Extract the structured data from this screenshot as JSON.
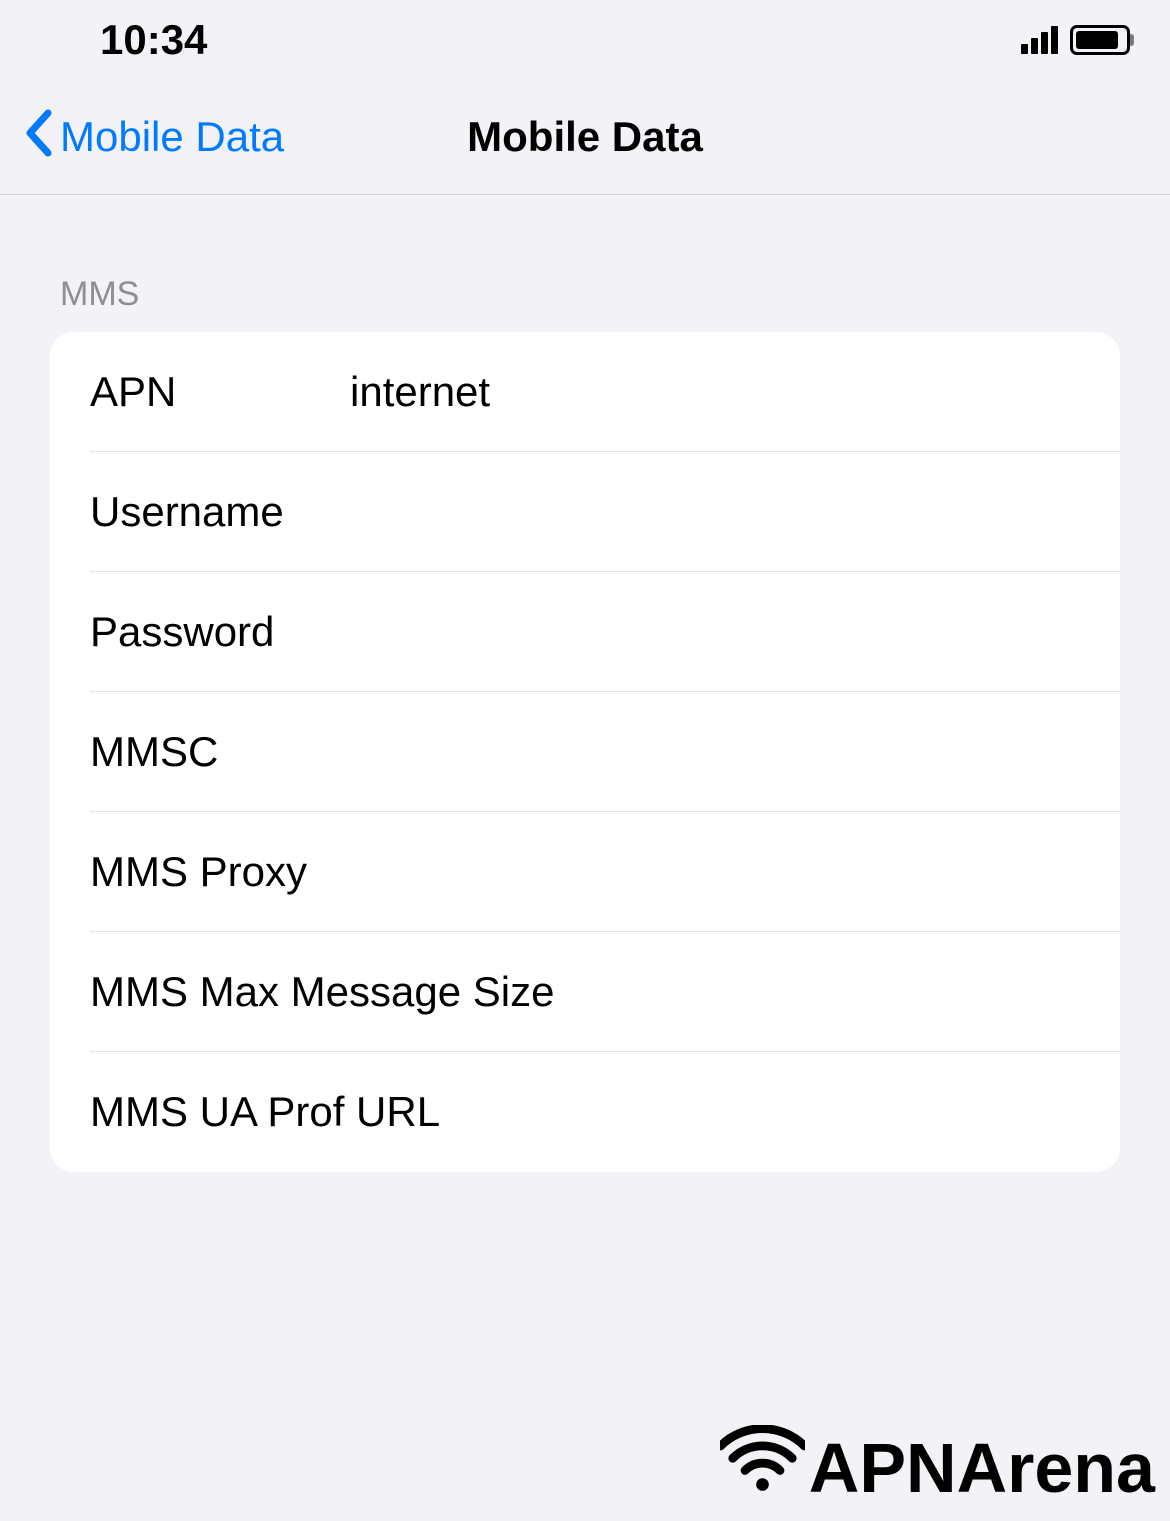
{
  "status": {
    "time": "10:34"
  },
  "nav": {
    "back_label": "Mobile Data",
    "title": "Mobile Data"
  },
  "section": {
    "header": "MMS"
  },
  "fields": {
    "apn": {
      "label": "APN",
      "value": "internet"
    },
    "username": {
      "label": "Username",
      "value": ""
    },
    "password": {
      "label": "Password",
      "value": ""
    },
    "mmsc": {
      "label": "MMSC",
      "value": ""
    },
    "mmsproxy": {
      "label": "MMS Proxy",
      "value": ""
    },
    "mmsmax": {
      "label": "MMS Max Message Size",
      "value": ""
    },
    "mmsua": {
      "label": "MMS UA Prof URL",
      "value": ""
    }
  },
  "watermark": {
    "text": "APNArena"
  }
}
